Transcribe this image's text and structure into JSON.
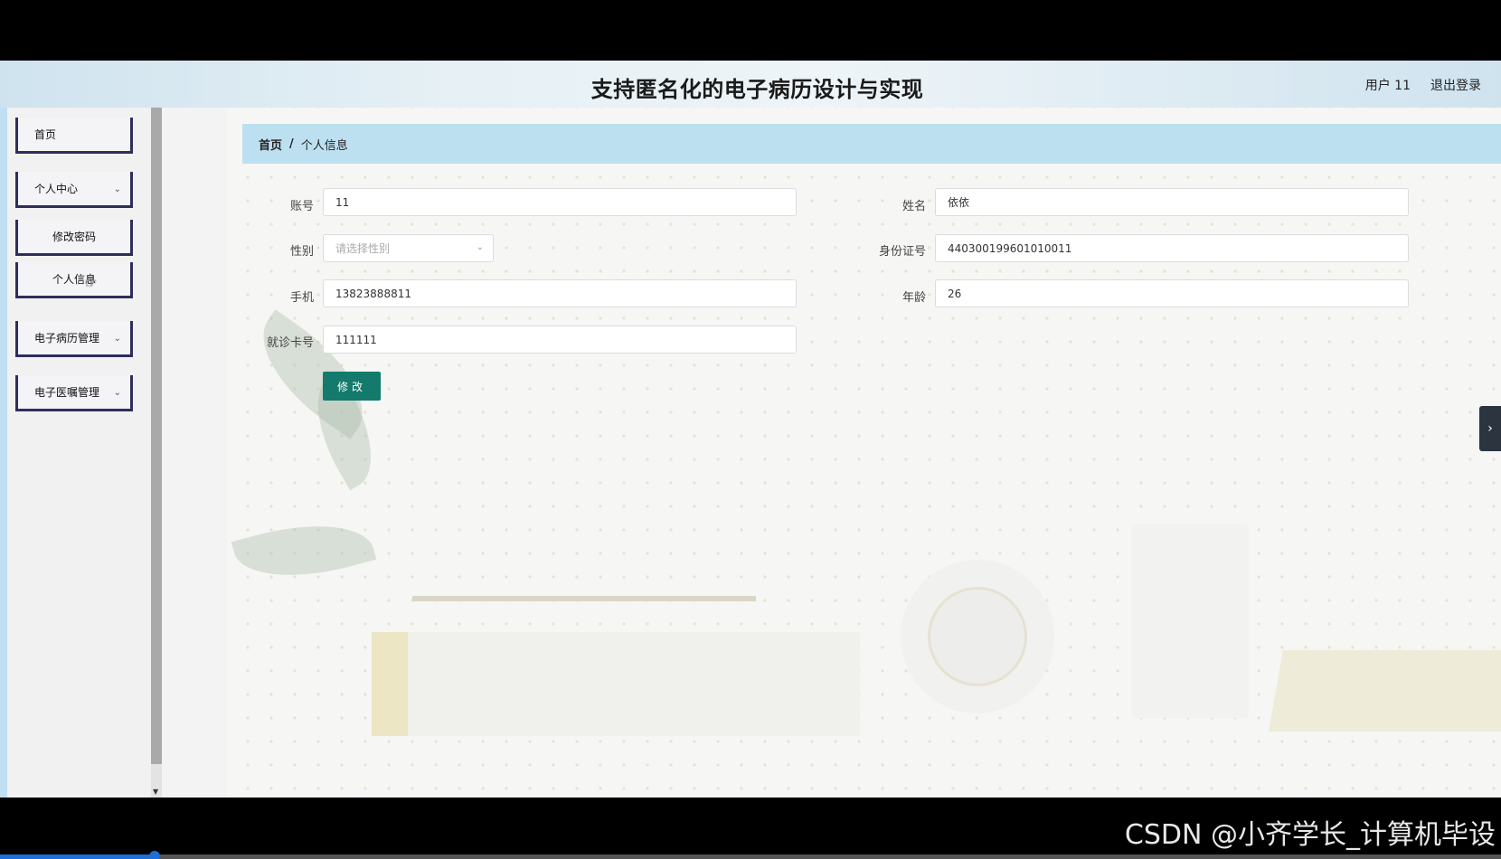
{
  "header": {
    "title": "支持匿名化的电子病历设计与实现",
    "user_label": "用户 11",
    "logout_label": "退出登录"
  },
  "sidebar": {
    "items": [
      {
        "label": "首页"
      },
      {
        "label": "个人中心"
      },
      {
        "label": "修改密码"
      },
      {
        "label": "个人信息"
      },
      {
        "label": "电子病历管理"
      },
      {
        "label": "电子医嘱管理"
      }
    ]
  },
  "breadcrumb": {
    "home": "首页",
    "separator": "/",
    "current": "个人信息"
  },
  "form": {
    "account": {
      "label": "账号",
      "value": "11"
    },
    "name": {
      "label": "姓名",
      "value": "依依"
    },
    "gender": {
      "label": "性别",
      "placeholder": "请选择性别"
    },
    "id_number": {
      "label": "身份证号",
      "value": "440300199601010011"
    },
    "phone": {
      "label": "手机",
      "value": "13823888811"
    },
    "age": {
      "label": "年龄",
      "value": "26"
    },
    "card_number": {
      "label": "就诊卡号",
      "value": "111111"
    },
    "submit_label": "修改"
  },
  "watermark": "CSDN @小齐学长_计算机毕设",
  "colors": {
    "primary_button": "#137a6c",
    "breadcrumb_bg": "#bde0f1",
    "sidebar_accent": "#2e2e5c"
  }
}
